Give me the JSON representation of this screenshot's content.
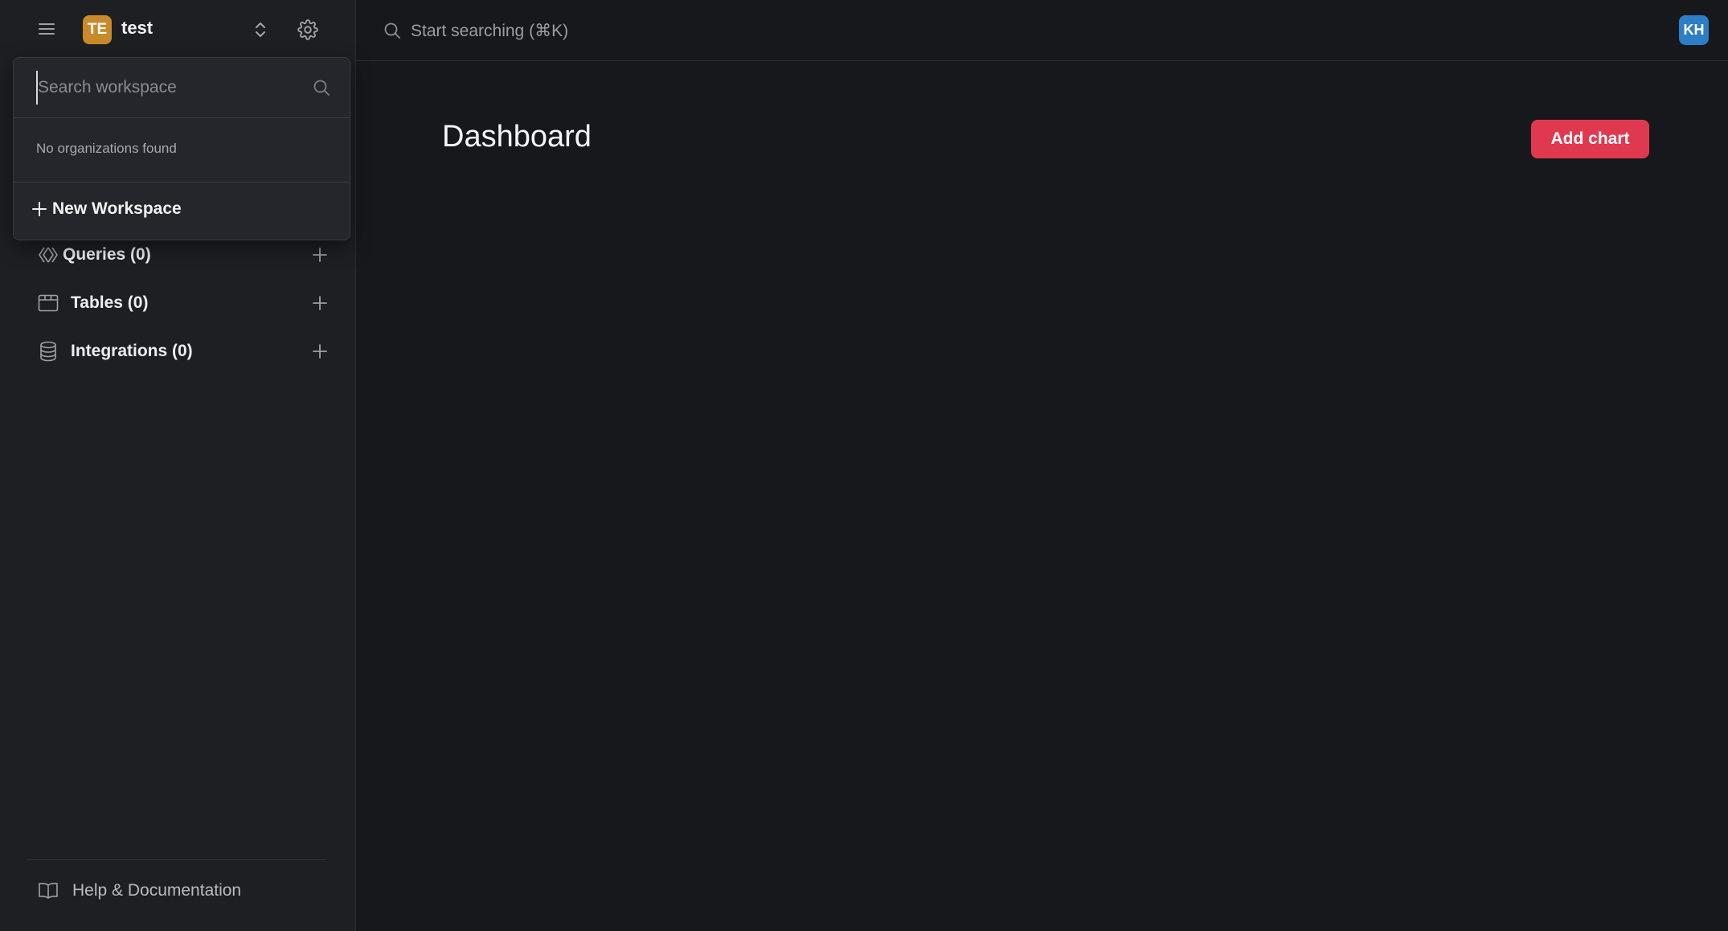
{
  "workspace": {
    "initials": "TE",
    "name": "test",
    "avatar_color": "#c98a2b"
  },
  "sidebar": {
    "items": [
      {
        "label": "Queries (0)",
        "icon": "queries-icon"
      },
      {
        "label": "Tables (0)",
        "icon": "table-icon"
      },
      {
        "label": "Integrations (0)",
        "icon": "database-icon"
      }
    ],
    "help_label": "Help & Documentation"
  },
  "topbar": {
    "search_placeholder": "Start searching (⌘K)",
    "user_initials": "KH",
    "user_avatar_color": "#2c7fc4"
  },
  "main": {
    "title": "Dashboard",
    "add_chart_label": "Add chart",
    "accent_color": "#e0394f"
  },
  "workspace_dropdown": {
    "search_placeholder": "Search workspace",
    "empty_text": "No organizations found",
    "new_workspace_label": "New Workspace"
  }
}
